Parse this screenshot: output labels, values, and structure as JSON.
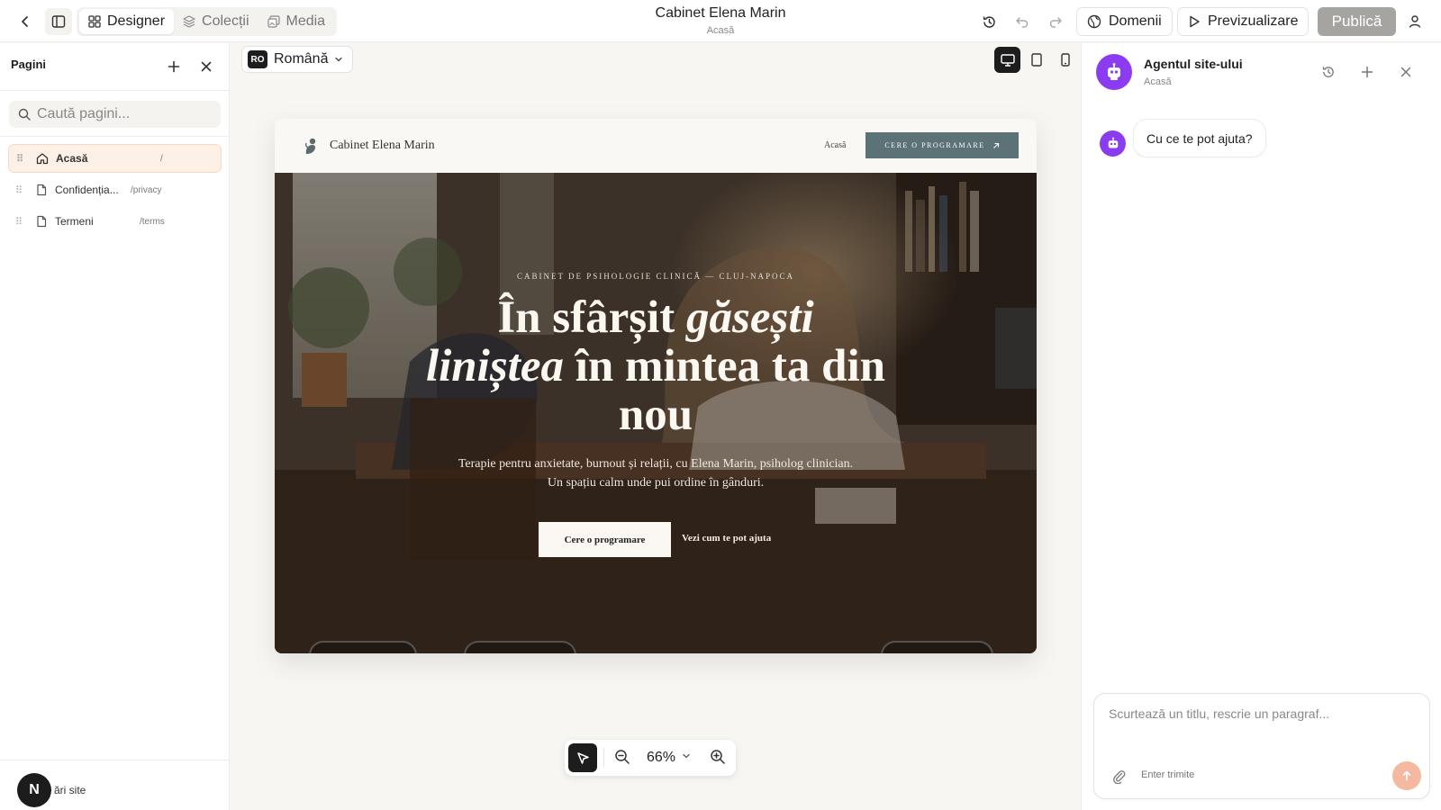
{
  "topbar": {
    "tabs": [
      {
        "label": "Designer",
        "icon": "grid-icon"
      },
      {
        "label": "Colecții",
        "icon": "layers-icon"
      },
      {
        "label": "Media",
        "icon": "image-icon"
      }
    ],
    "site_title": "Cabinet Elena Marin",
    "page_subtitle": "Acasă",
    "domains_label": "Domenii",
    "preview_label": "Previzualizare",
    "publish_label": "Publică"
  },
  "sidebar": {
    "heading": "Pagini",
    "search_placeholder": "Caută pagini...",
    "pages": [
      {
        "label": "Acasă",
        "path": "/",
        "icon": "home-icon",
        "active": true
      },
      {
        "label": "Confidenția...",
        "path": "/privacy",
        "icon": "file-icon",
        "active": false
      },
      {
        "label": "Termeni",
        "path": "/terms",
        "icon": "file-icon",
        "active": false
      }
    ],
    "footer_avatar": "N",
    "footer_label": "etări site"
  },
  "canvas": {
    "language_code": "RO",
    "language_label": "Română",
    "zoom": "66%"
  },
  "preview": {
    "brand": "Cabinet Elena Marin",
    "nav_link": "Acasă",
    "nav_cta": "CERE O PROGRAMARE",
    "eyebrow": "CABINET DE PSIHOLOGIE CLINICĂ — CLUJ-NAPOCA",
    "headline_1": "În sfârșit ",
    "headline_2": "găsești",
    "headline_3": "liniștea",
    "headline_4": " în mintea ta din nou",
    "subtitle": "Terapie pentru anxietate, burnout și relații, cu Elena Marin, psiholog clinician. Un spațiu calm unde pui ordine în gânduri.",
    "primary_button": "Cere o programare",
    "secondary_link": "Vezi cum te pot ajuta"
  },
  "agent": {
    "title": "Agentul site-ului",
    "subtitle": "Acasă",
    "greeting": "Cu ce te pot ajuta?",
    "input_placeholder": "Scurtează un titlu, rescrie un paragraf...",
    "hint": "Enter trimite"
  },
  "colors": {
    "accent_orange": "#f4b9a0",
    "agent_purple": "#8b3cf0",
    "cta_teal": "#5b7276",
    "publish_gray": "#a5a4a1"
  }
}
